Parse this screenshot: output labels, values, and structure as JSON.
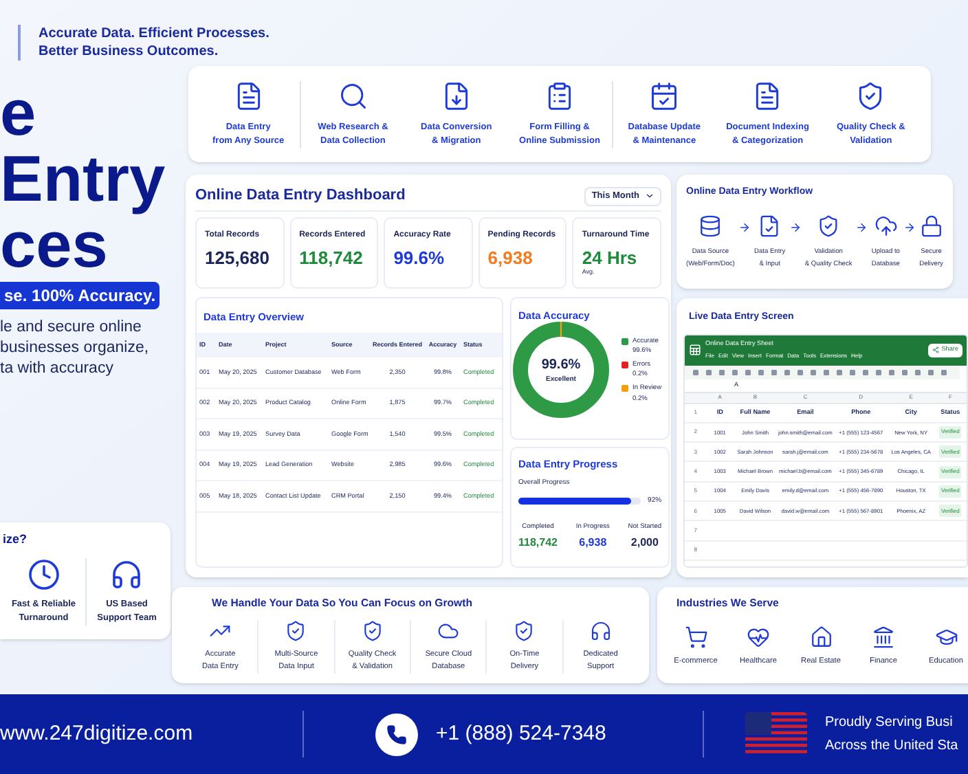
{
  "tagline": [
    "Accurate Data. Efficient Processes.",
    "Better Business Outcomes."
  ],
  "hero": {
    "title_lines": [
      "e",
      "Entry",
      "ces"
    ],
    "badge": "se. 100% Accuracy.",
    "description_lines": [
      "le and secure online",
      "businesses organize,",
      "ta with accuracy"
    ]
  },
  "why_card": {
    "title": "ize?",
    "items": [
      {
        "label": [
          "Fast & Reliable",
          "Turnaround"
        ]
      },
      {
        "label": [
          "US Based",
          "Support Team"
        ]
      }
    ]
  },
  "services": [
    {
      "label": [
        "Data Entry",
        "from Any Source"
      ]
    },
    {
      "label": [
        "Web Research &",
        "Data Collection"
      ]
    },
    {
      "label": [
        "Data Conversion",
        "& Migration"
      ]
    },
    {
      "label": [
        "Form Filling &",
        "Online Submission"
      ]
    },
    {
      "label": [
        "Database Update",
        "& Maintenance"
      ]
    },
    {
      "label": [
        "Document Indexing",
        "& Categorization"
      ]
    },
    {
      "label": [
        "Quality Check &",
        "Validation"
      ]
    }
  ],
  "dashboard": {
    "title": "Online Data Entry Dashboard",
    "period": "This Month",
    "stats": [
      {
        "label": "Total Records",
        "value": "125,680",
        "color": "#1b2559"
      },
      {
        "label": "Records Entered",
        "value": "118,742",
        "color": "#1f8a3b"
      },
      {
        "label": "Accuracy Rate",
        "value": "99.6%",
        "color": "#1f3bd6"
      },
      {
        "label": "Pending Records",
        "value": "6,938",
        "color": "#f47b20"
      },
      {
        "label": "Turnaround Time",
        "value": "24 Hrs",
        "note": "Avg.",
        "color": "#1f8a3b"
      }
    ],
    "overview": {
      "title": "Data Entry Overview",
      "columns": [
        "ID",
        "Date",
        "Project",
        "Source",
        "Records Entered",
        "Accuracy",
        "Status"
      ],
      "rows": [
        [
          "001",
          "May 20, 2025",
          "Customer Database",
          "Web Form",
          "2,350",
          "99.8%",
          "Completed"
        ],
        [
          "002",
          "May 20, 2025",
          "Product Catalog",
          "Online Form",
          "1,875",
          "99.7%",
          "Completed"
        ],
        [
          "003",
          "May 19, 2025",
          "Survey Data",
          "Google Form",
          "1,540",
          "99.5%",
          "Completed"
        ],
        [
          "004",
          "May 19, 2025",
          "Lead Generation",
          "Website",
          "2,985",
          "99.6%",
          "Completed"
        ],
        [
          "005",
          "May 18, 2025",
          "Contact List Update",
          "CRM Portal",
          "2,150",
          "99.4%",
          "Completed"
        ]
      ]
    },
    "accuracy": {
      "title": "Data Accuracy",
      "center_value": "99.6%",
      "center_label": "Excellent",
      "legend": [
        {
          "label": "Accurate",
          "value": "99.6%",
          "color": "#2e9a45"
        },
        {
          "label": "Errors",
          "value": "0.2%",
          "color": "#e02424"
        },
        {
          "label": "In Review",
          "value": "0.2%",
          "color": "#f59e0b"
        }
      ]
    },
    "progress": {
      "title": "Data Entry Progress",
      "label": "Overall Progress",
      "level": 0.92,
      "reading": "92%",
      "stats": [
        {
          "label": "Completed",
          "value": "118,742",
          "color": "#1f8a3b"
        },
        {
          "label": "In Progress",
          "value": "6,938",
          "color": "#1f3bd6"
        },
        {
          "label": "Not Started",
          "value": "2,000",
          "color": "#1b2559"
        }
      ]
    }
  },
  "workflow": {
    "title": "Online Data Entry Workflow",
    "steps": [
      {
        "label": [
          "Data Source",
          "(Web/Form/Doc)"
        ]
      },
      {
        "label": [
          "Data Entry",
          "& Input"
        ]
      },
      {
        "label": [
          "Validation",
          "& Quality Check"
        ]
      },
      {
        "label": [
          "Upload to",
          "Database"
        ]
      },
      {
        "label": [
          "Secure",
          "Delivery"
        ]
      }
    ]
  },
  "live_screen": {
    "title": "Live Data Entry Screen",
    "sheet_title": "Online Data Entry Sheet",
    "menu": [
      "File",
      "Edit",
      "View",
      "Insert",
      "Format",
      "Data",
      "Tools",
      "Extensions",
      "Help"
    ],
    "share": "Share",
    "cell_value": "A",
    "column_letters": [
      "A",
      "B",
      "C",
      "D",
      "E",
      "F"
    ],
    "row_numbers": [
      "1",
      "2",
      "3",
      "4",
      "5",
      "6",
      "7",
      "8"
    ],
    "header": [
      "ID",
      "Full Name",
      "Email",
      "Phone",
      "City",
      "Status"
    ],
    "rows": [
      [
        "1001",
        "John Smith",
        "john.smith@email.com",
        "+1 (555) 123-4567",
        "New York, NY",
        "Verified"
      ],
      [
        "1002",
        "Sarah Johnson",
        "sarah.j@email.com",
        "+1 (555) 234-5678",
        "Los Angeles, CA",
        "Verified"
      ],
      [
        "1003",
        "Michael Brown",
        "michael.b@email.com",
        "+1 (555) 345-6789",
        "Chicago, IL",
        "Verified"
      ],
      [
        "1004",
        "Emily Davis",
        "emily.d@email.com",
        "+1 (555) 456-7890",
        "Houston, TX",
        "Verified"
      ],
      [
        "1005",
        "David Wilson",
        "david.w@email.com",
        "+1 (555) 567-8901",
        "Phoenix, AZ",
        "Verified"
      ]
    ]
  },
  "benefits": {
    "title": "We Handle Your Data So You Can Focus on Growth",
    "items": [
      {
        "label": [
          "Accurate",
          "Data Entry"
        ]
      },
      {
        "label": [
          "Multi-Source",
          "Data Input"
        ]
      },
      {
        "label": [
          "Quality Check",
          "& Validation"
        ]
      },
      {
        "label": [
          "Secure Cloud",
          "Database"
        ]
      },
      {
        "label": [
          "On-Time",
          "Delivery"
        ]
      },
      {
        "label": [
          "Dedicated",
          "Support"
        ]
      }
    ]
  },
  "industries": {
    "title": "Industries We Serve",
    "items": [
      {
        "label": "E-commerce"
      },
      {
        "label": "Healthcare"
      },
      {
        "label": "Real Estate"
      },
      {
        "label": "Finance"
      },
      {
        "label": "Education"
      }
    ]
  },
  "footer": {
    "website": "www.247digitize.com",
    "phone": "+1 (888) 524-7348",
    "serving_lines": [
      "Proudly Serving Busi",
      "Across the United Sta"
    ]
  }
}
